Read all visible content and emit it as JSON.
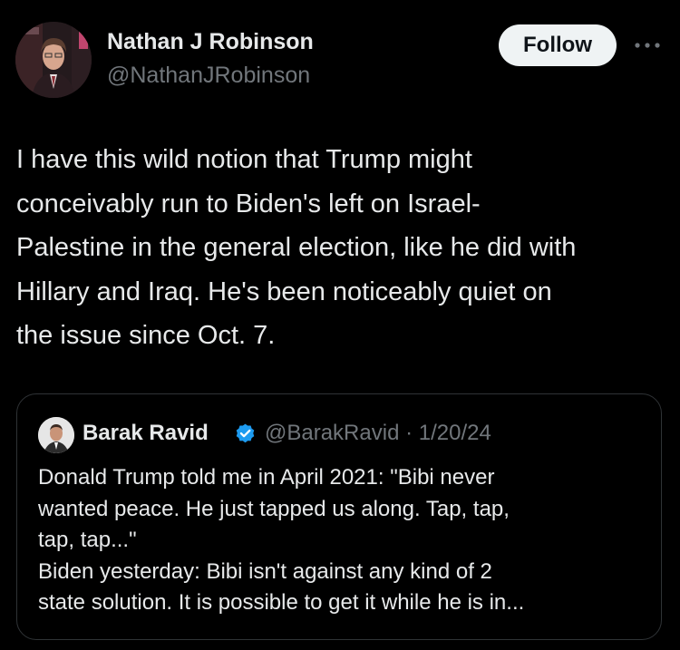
{
  "author": {
    "name": "Nathan J Robinson",
    "handle": "@NathanJRobinson"
  },
  "follow_label": "Follow",
  "more_icon": "more-horizontal-icon",
  "tweet": {
    "lines": [
      "I have this wild notion that Trump might",
      "conceivably run to Biden's left on Israel-",
      "Palestine in the general election, like he did with",
      "Hillary and Iraq. He's been noticeably quiet on",
      "the issue since Oct. 7."
    ]
  },
  "quote": {
    "name": "Barak Ravid",
    "verified_icon": "verified-badge-icon",
    "handle_date": "@BarakRavid · 1/20/24",
    "lines": [
      "Donald Trump told me in April 2021: \"Bibi never",
      "wanted peace. He just tapped us along. Tap, tap,",
      "tap, tap...\"",
      "Biden yesterday: Bibi isn't against any kind of 2",
      "state solution. It is possible to get it while he is in..."
    ]
  },
  "colors": {
    "background": "#000000",
    "text": "#e7e9ea",
    "secondary_text": "#71767b",
    "verified_blue": "#1d9bf0",
    "follow_bg": "#eff3f4",
    "border": "#2f3336"
  }
}
